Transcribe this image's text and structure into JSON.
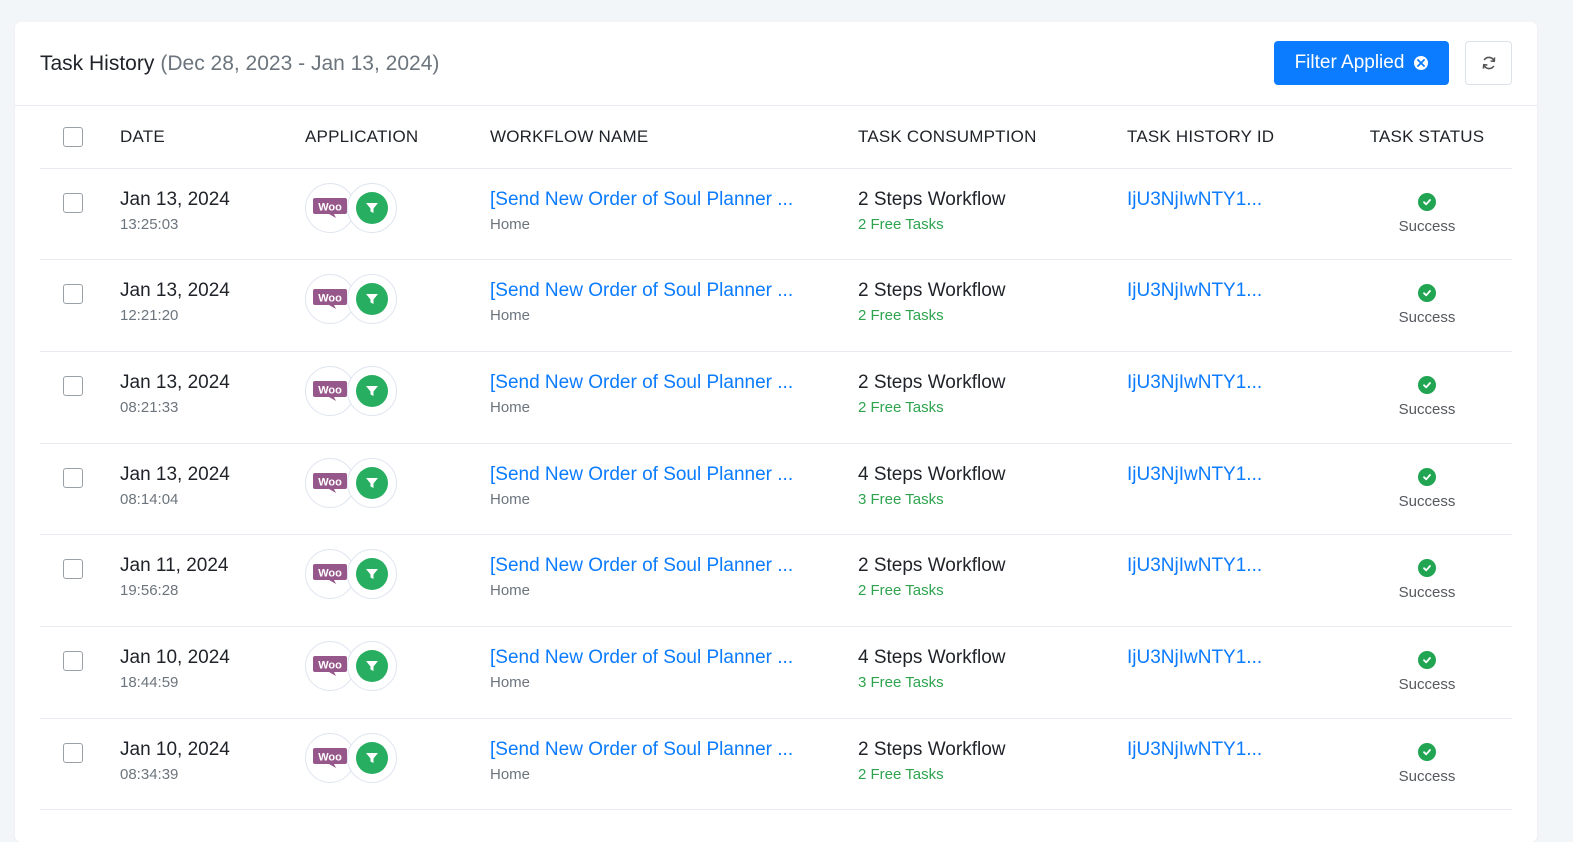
{
  "header": {
    "title": "Task History",
    "date_range": "(Dec 28, 2023 - Jan 13, 2024)",
    "filter_label": "Filter Applied"
  },
  "columns": {
    "date": "DATE",
    "application": "APPLICATION",
    "workflow": "WORKFLOW NAME",
    "consumption": "TASK CONSUMPTION",
    "history_id": "TASK HISTORY ID",
    "status": "TASK STATUS"
  },
  "colors": {
    "accent": "#0b7bff",
    "success": "#22a553",
    "woo": "#96588a"
  },
  "icons": {
    "woo": "woocommerce-icon",
    "filter": "filter-icon",
    "status": "check-circle-icon",
    "refresh": "refresh-icon"
  },
  "rows": [
    {
      "date": "Jan 13, 2024",
      "time": "13:25:03",
      "workflow": "[Send New Order of Soul Planner ...",
      "folder": "Home",
      "steps": "2 Steps Workflow",
      "free": "2 Free Tasks",
      "id": "IjU3NjIwNTY1...",
      "status": "Success"
    },
    {
      "date": "Jan 13, 2024",
      "time": "12:21:20",
      "workflow": "[Send New Order of Soul Planner ...",
      "folder": "Home",
      "steps": "2 Steps Workflow",
      "free": "2 Free Tasks",
      "id": "IjU3NjIwNTY1...",
      "status": "Success"
    },
    {
      "date": "Jan 13, 2024",
      "time": "08:21:33",
      "workflow": "[Send New Order of Soul Planner ...",
      "folder": "Home",
      "steps": "2 Steps Workflow",
      "free": "2 Free Tasks",
      "id": "IjU3NjIwNTY1...",
      "status": "Success"
    },
    {
      "date": "Jan 13, 2024",
      "time": "08:14:04",
      "workflow": "[Send New Order of Soul Planner ...",
      "folder": "Home",
      "steps": "4 Steps Workflow",
      "free": "3 Free Tasks",
      "id": "IjU3NjIwNTY1...",
      "status": "Success"
    },
    {
      "date": "Jan 11, 2024",
      "time": "19:56:28",
      "workflow": "[Send New Order of Soul Planner ...",
      "folder": "Home",
      "steps": "2 Steps Workflow",
      "free": "2 Free Tasks",
      "id": "IjU3NjIwNTY1...",
      "status": "Success"
    },
    {
      "date": "Jan 10, 2024",
      "time": "18:44:59",
      "workflow": "[Send New Order of Soul Planner ...",
      "folder": "Home",
      "steps": "4 Steps Workflow",
      "free": "3 Free Tasks",
      "id": "IjU3NjIwNTY1...",
      "status": "Success"
    },
    {
      "date": "Jan 10, 2024",
      "time": "08:34:39",
      "workflow": "[Send New Order of Soul Planner ...",
      "folder": "Home",
      "steps": "2 Steps Workflow",
      "free": "2 Free Tasks",
      "id": "IjU3NjIwNTY1...",
      "status": "Success"
    }
  ]
}
